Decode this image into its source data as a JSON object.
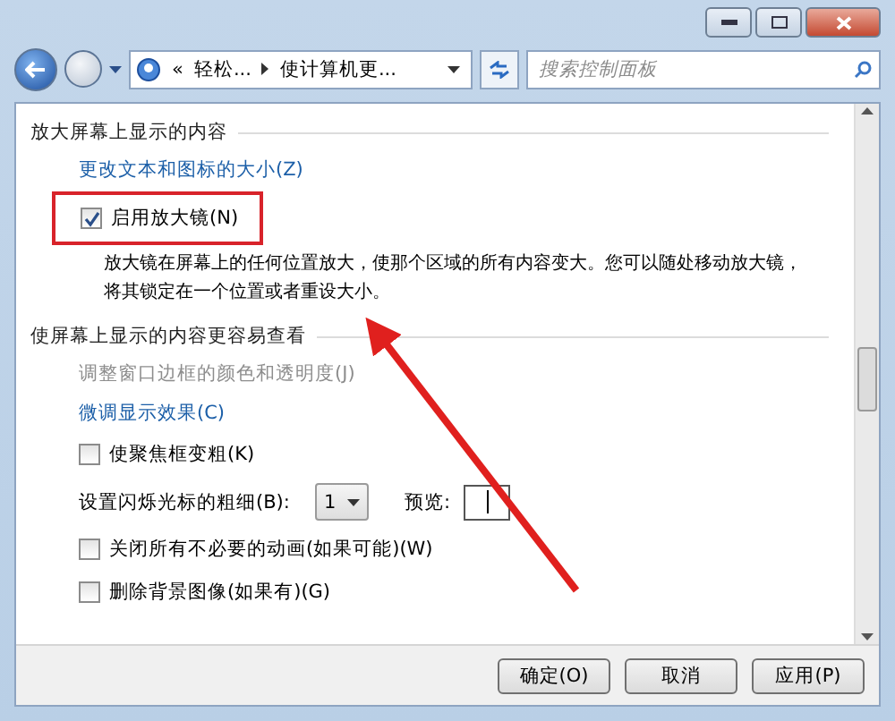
{
  "address_bar": {
    "overflow": "«",
    "crumbs": [
      "轻松...",
      "使计算机更..."
    ]
  },
  "search": {
    "placeholder": "搜索控制面板"
  },
  "sections": [
    {
      "heading": "放大屏幕上显示的内容",
      "items": [
        {
          "kind": "link",
          "text": "更改文本和图标的大小(Z)",
          "disabled": false
        },
        {
          "kind": "checkbox",
          "label": "启用放大镜(N)",
          "checked": true,
          "annotated": true
        },
        {
          "kind": "description",
          "text": "放大镜在屏幕上的任何位置放大，使那个区域的所有内容变大。您可以随处移动放大镜，将其锁定在一个位置或者重设大小。"
        }
      ]
    },
    {
      "heading": "使屏幕上显示的内容更容易查看",
      "items": [
        {
          "kind": "link",
          "text": "调整窗口边框的颜色和透明度(J)",
          "disabled": true
        },
        {
          "kind": "link",
          "text": "微调显示效果(C)",
          "disabled": false
        },
        {
          "kind": "checkbox",
          "label": "使聚焦框变粗(K)",
          "checked": false,
          "annotated": false
        },
        {
          "kind": "select_row",
          "label": "设置闪烁光标的粗细(B):",
          "value": "1",
          "preview_label": "预览:"
        },
        {
          "kind": "checkbox",
          "label": "关闭所有不必要的动画(如果可能)(W)",
          "checked": false,
          "annotated": false
        },
        {
          "kind": "checkbox",
          "label": "删除背景图像(如果有)(G)",
          "checked": false,
          "annotated": false
        }
      ]
    }
  ],
  "buttons": [
    {
      "label": "确定(O)"
    },
    {
      "label": "取消"
    },
    {
      "label": "应用(P)"
    }
  ]
}
